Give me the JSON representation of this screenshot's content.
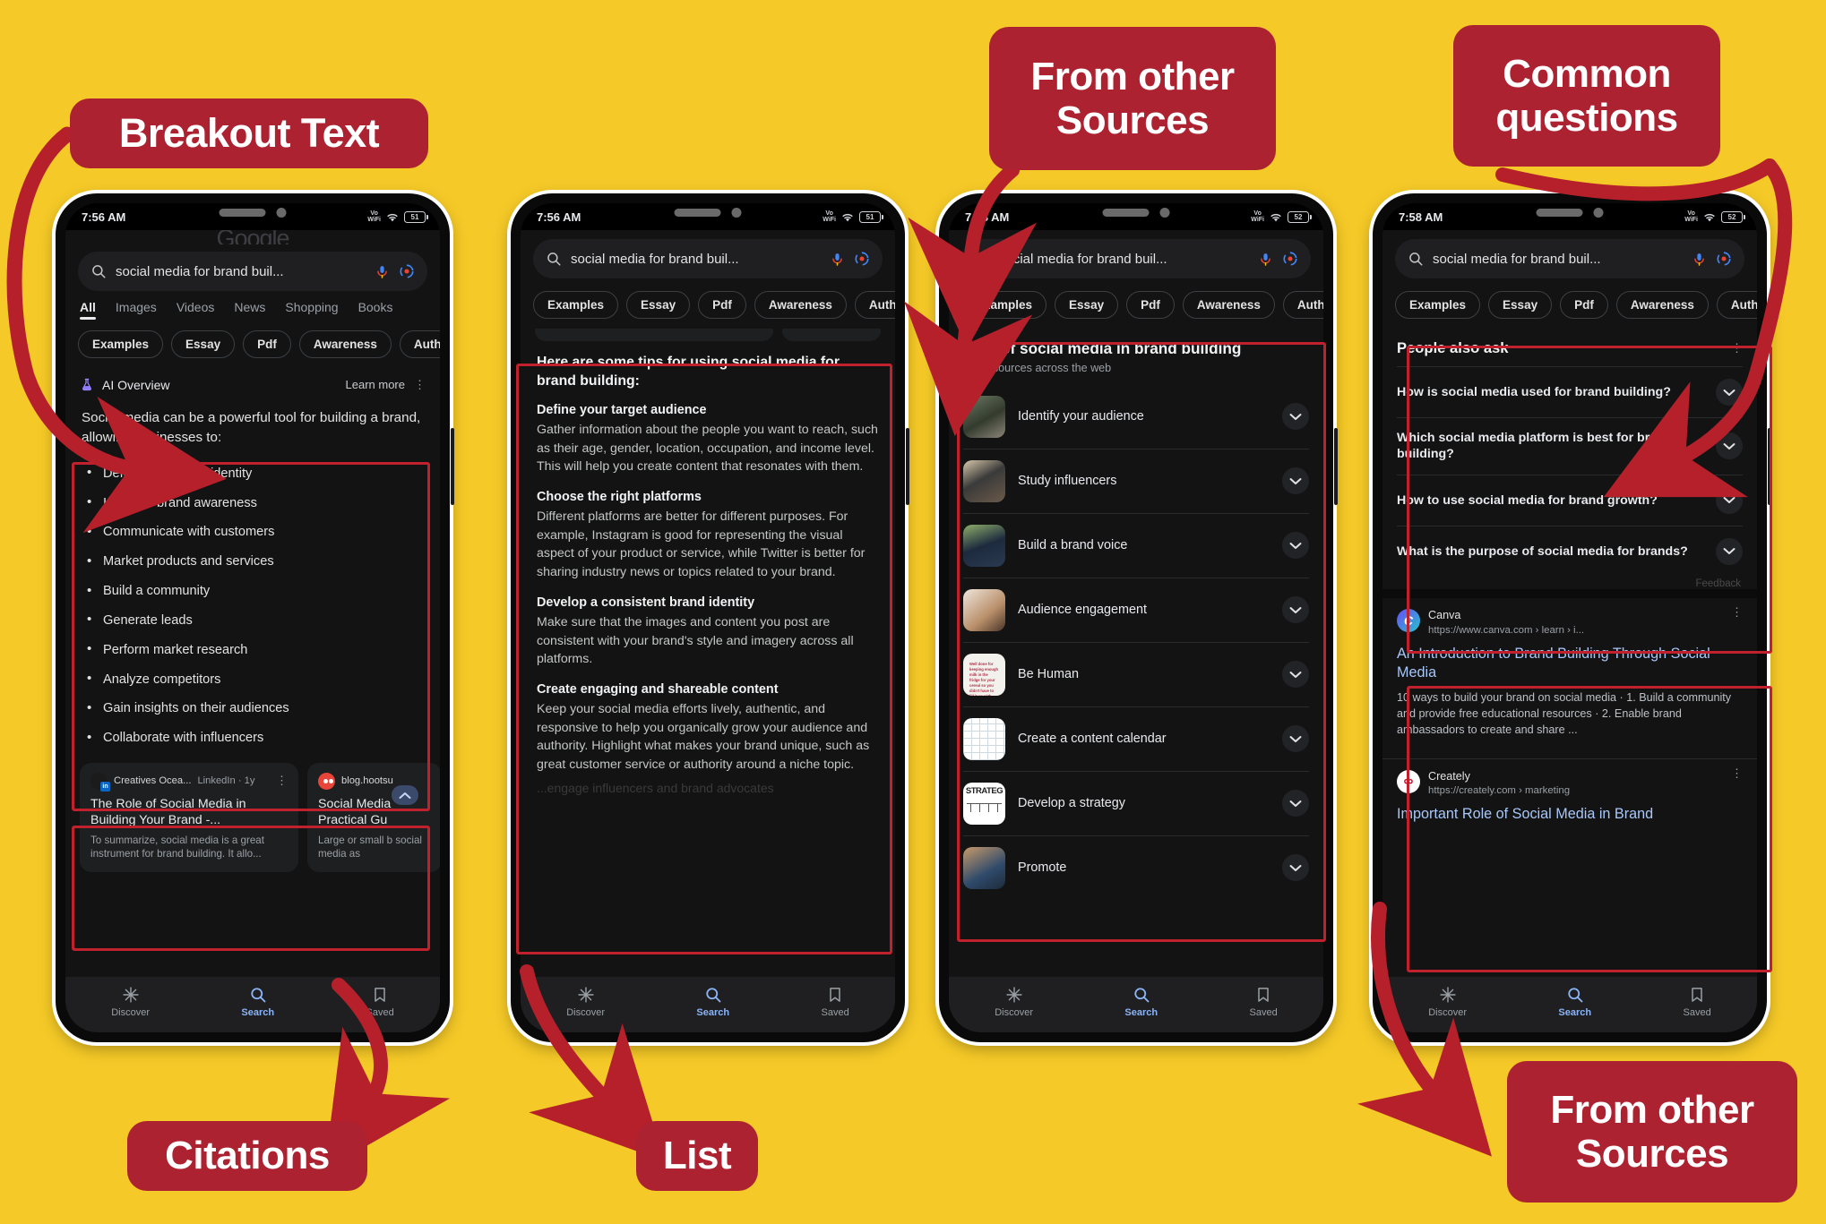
{
  "background_color": "#F5C927",
  "callout_color": "#AD2230",
  "highlight_color": "#C0212C",
  "callouts": {
    "breakout_text": "Breakout Text",
    "from_other_sources_top": "From other\nSources",
    "common_questions": "Common\nquestions",
    "citations": "Citations",
    "list": "List",
    "from_other_sources_bottom": "From other\nSources"
  },
  "phones": [
    {
      "status": {
        "time": "7:56 AM",
        "network": "VoWiFi",
        "battery": "51"
      },
      "logo": "Google",
      "search": {
        "query": "social media for brand buil...",
        "search_icon": "search-icon",
        "mic_icon": "mic-icon",
        "lens_icon": "lens-icon"
      },
      "nav_tabs": [
        "All",
        "Images",
        "Videos",
        "News",
        "Shopping",
        "Books"
      ],
      "active_nav_tab": "All",
      "chips": [
        "Examples",
        "Essay",
        "Pdf",
        "Awareness",
        "Author"
      ],
      "ai_overview": {
        "label": "AI Overview",
        "learn_more": "Learn more",
        "lead": "Social media can be a powerful tool for building a brand, allowing businesses to:",
        "bullets": [
          "Define their brand identity",
          "Increase brand awareness",
          "Communicate with customers",
          "Market products and services",
          "Build a community",
          "Generate leads",
          "Perform market research",
          "Analyze competitors",
          "Gain insights on their audiences",
          "Collaborate with influencers"
        ]
      },
      "citations": [
        {
          "source": "Creatives Ocea...",
          "meta": "LinkedIn · 1y",
          "title": "The Role of Social Media in Building Your Brand -...",
          "snippet": "To summarize, social media is a great instrument for brand building. It allo...",
          "favicon_color": "#1B1B1B",
          "badge": "in"
        },
        {
          "source": "blog.hootsu",
          "meta": "",
          "title": "Social Media Practical Gu",
          "snippet": "Large or small b social media as",
          "favicon_color": "#E8443A",
          "badge": ""
        }
      ],
      "bottom_nav": [
        {
          "label": "Discover",
          "icon": "sparkle-icon",
          "active": false
        },
        {
          "label": "Search",
          "icon": "search-icon",
          "active": true
        },
        {
          "label": "Saved",
          "icon": "bookmark-icon",
          "active": false
        }
      ]
    },
    {
      "status": {
        "time": "7:56 AM",
        "network": "VoWiFi",
        "battery": "51"
      },
      "search": {
        "query": "social media for brand buil..."
      },
      "chips": [
        "Examples",
        "Essay",
        "Pdf",
        "Awareness",
        "Author"
      ],
      "tips": {
        "heading": "Here are some tips for using social media for brand building:",
        "sections": [
          {
            "title": "Define your target audience",
            "body": "Gather information about the people you want to reach, such as their age, gender, location, occupation, and income level. This will help you create content that resonates with them."
          },
          {
            "title": "Choose the right platforms",
            "body": "Different platforms are better for different purposes. For example, Instagram is good for representing the visual aspect of your product or service, while Twitter is better for sharing industry news or topics related to your brand."
          },
          {
            "title": "Develop a consistent brand identity",
            "body": "Make sure that the images and content you post are consistent with your brand's style and imagery across all platforms."
          },
          {
            "title": "Create engaging and shareable content",
            "body": "Keep your social media efforts lively, authentic, and responsive to help you organically grow your audience and authority. Highlight what makes your brand unique, such as great customer service or authority around a niche topic."
          }
        ],
        "cutoff_line": "...engage influencers and brand advocates"
      },
      "bottom_nav": [
        {
          "label": "Discover",
          "icon": "sparkle-icon",
          "active": false
        },
        {
          "label": "Search",
          "icon": "search-icon",
          "active": true
        },
        {
          "label": "Saved",
          "icon": "bookmark-icon",
          "active": false
        }
      ]
    },
    {
      "status": {
        "time": "7:58 AM",
        "network": "VoWiFi",
        "battery": "52"
      },
      "search": {
        "query": "social media for brand buil..."
      },
      "chips": [
        "Examples",
        "Essay",
        "Pdf",
        "Awareness",
        "Author"
      ],
      "from_other_sources": {
        "title": "Role of social media in brand building",
        "subtitle": "From sources across the web",
        "items": [
          {
            "label": "Identify your audience",
            "thumb": "people-looking-at-phone"
          },
          {
            "label": "Study influencers",
            "thumb": "laptop-video-call"
          },
          {
            "label": "Build a brand voice",
            "thumb": "phone-and-monitor"
          },
          {
            "label": "Audience engagement",
            "thumb": "hand-holding-phone"
          },
          {
            "label": "Be Human",
            "thumb": "handwritten-note"
          },
          {
            "label": "Create a content calendar",
            "thumb": "calendar-grid"
          },
          {
            "label": "Develop a strategy",
            "thumb": "strategy-diagram"
          },
          {
            "label": "Promote",
            "thumb": "person-smiling"
          }
        ]
      },
      "bottom_nav": [
        {
          "label": "Discover",
          "icon": "sparkle-icon",
          "active": false
        },
        {
          "label": "Search",
          "icon": "search-icon",
          "active": true
        },
        {
          "label": "Saved",
          "icon": "bookmark-icon",
          "active": false
        }
      ]
    },
    {
      "status": {
        "time": "7:58 AM",
        "network": "VoWiFi",
        "battery": "52"
      },
      "search": {
        "query": "social media for brand buil..."
      },
      "chips": [
        "Examples",
        "Essay",
        "Pdf",
        "Awareness",
        "Author"
      ],
      "people_also_ask": {
        "title": "People also ask",
        "questions": [
          "How is social media used for brand building?",
          "Which social media platform is best for brand building?",
          "How to use social media for brand growth?",
          "What is the purpose of social media for brands?"
        ],
        "feedback": "Feedback"
      },
      "results": [
        {
          "site": "Canva",
          "url": "https://www.canva.com › learn › i...",
          "title": "An Introduction to Brand Building Through Social Media",
          "snippet": "10 ways to build your brand on social media · 1. Build a community and provide free educational resources · 2. Enable brand ambassadors to create and share ...",
          "favicon_color": "#2CC3D5",
          "favicon_letter": "C"
        },
        {
          "site": "Creately",
          "url": "https://creately.com › marketing",
          "title": "Important Role of Social Media in Brand",
          "snippet": "",
          "favicon_color": "#FFFFFF",
          "favicon_letter": "∞"
        }
      ],
      "bottom_nav": [
        {
          "label": "Discover",
          "icon": "sparkle-icon",
          "active": false
        },
        {
          "label": "Search",
          "icon": "search-icon",
          "active": true
        },
        {
          "label": "Saved",
          "icon": "bookmark-icon",
          "active": false
        }
      ]
    }
  ]
}
